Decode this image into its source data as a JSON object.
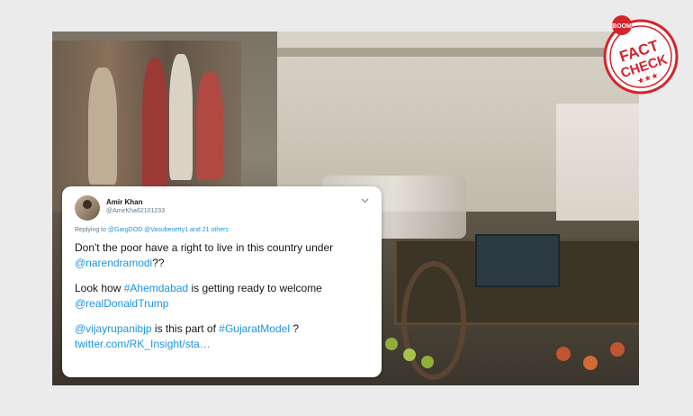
{
  "tweet": {
    "author_name": "Amir Khan",
    "author_handle": "@AmirKha62101233",
    "replying_label": "Replying to",
    "replying_mentions": [
      "@GargDOD",
      "@Vasubesetty1"
    ],
    "replying_others": "and 21 others",
    "line1_text": "Don't the poor have a right to live in this country under",
    "line1_mention": "@narendramodi",
    "line1_suffix": "??",
    "line2_prefix": "Look how",
    "line2_hashtag": "#Ahemdabad",
    "line2_text": "is getting ready to welcome",
    "line2_mention": "@realDonaldTrump",
    "line3_mention": "@vijayrupanibjp",
    "line3_text": "is this part of",
    "line3_hashtag": "#GujaratModel",
    "line3_suffix": "?",
    "link": "twitter.com/RK_Insight/sta…"
  },
  "stamp": {
    "top_text": "BOOM",
    "line1": "FACT",
    "line2": "CHECK",
    "stars": "★★★",
    "color": "#d6232a"
  },
  "icons": {
    "chevron": "chevron-down-icon",
    "avatar": "avatar"
  }
}
